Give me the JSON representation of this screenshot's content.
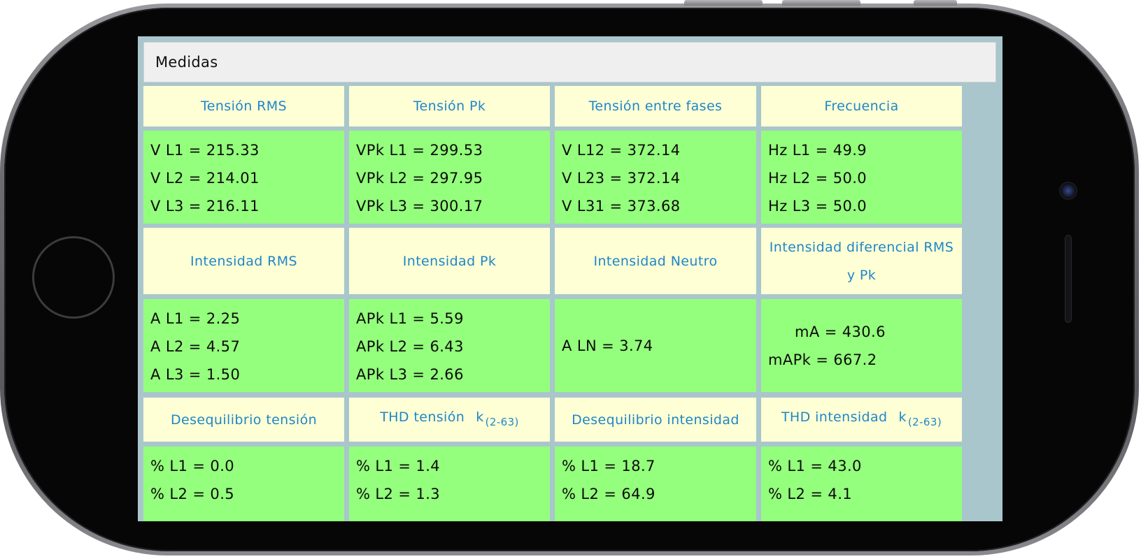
{
  "title": "Medidas",
  "colors": {
    "header_bg": "#ffffd6",
    "header_text": "#1f86c8",
    "value_bg": "#94ff7c",
    "grid_border": "#a9c6cc"
  },
  "sections": [
    {
      "headers": [
        {
          "text": "Tensión RMS"
        },
        {
          "text": "Tensión Pk"
        },
        {
          "text": "Tensión entre fases"
        },
        {
          "text": "Frecuencia"
        }
      ],
      "values": [
        [
          "V L1 = 215.33",
          "V L2 = 214.01",
          "V L3 = 216.11"
        ],
        [
          "VPk L1 = 299.53",
          "VPk L2 = 297.95",
          "VPk L3 = 300.17"
        ],
        [
          "V L12 = 372.14",
          "V L23 = 372.14",
          "V L31 = 373.68"
        ],
        [
          "Hz L1 = 49.9",
          "Hz L2 = 50.0",
          "Hz L3 = 50.0"
        ]
      ]
    },
    {
      "headers": [
        {
          "text": "Intensidad RMS"
        },
        {
          "text": "Intensidad Pk"
        },
        {
          "text": "Intensidad Neutro"
        },
        {
          "text": "Intensidad diferencial RMS y Pk"
        }
      ],
      "values": [
        [
          "A L1 = 2.25",
          "A L2 = 4.57",
          "A L3 = 1.50"
        ],
        [
          "APk L1 = 5.59",
          "APk L2 = 6.43",
          "APk L3 = 2.66"
        ],
        [
          "A LN = 3.74"
        ],
        [
          "mA = 430.6",
          "mAPk = 667.2"
        ]
      ]
    },
    {
      "headers": [
        {
          "text": "Desequilibrio tensión"
        },
        {
          "text": "THD tensión",
          "sub": "k",
          "subscript": "(2-63)"
        },
        {
          "text": "Desequilibrio intensidad"
        },
        {
          "text": "THD intensidad",
          "sub": "k",
          "subscript": "(2-63)"
        }
      ],
      "values": [
        [
          "% L1 = 0.0",
          "% L2 = 0.5"
        ],
        [
          "% L1 = 1.4",
          "% L2 = 1.3"
        ],
        [
          "% L1 = 18.7",
          "% L2 = 64.9"
        ],
        [
          "% L1 = 43.0",
          "% L2 = 4.1"
        ]
      ]
    }
  ]
}
